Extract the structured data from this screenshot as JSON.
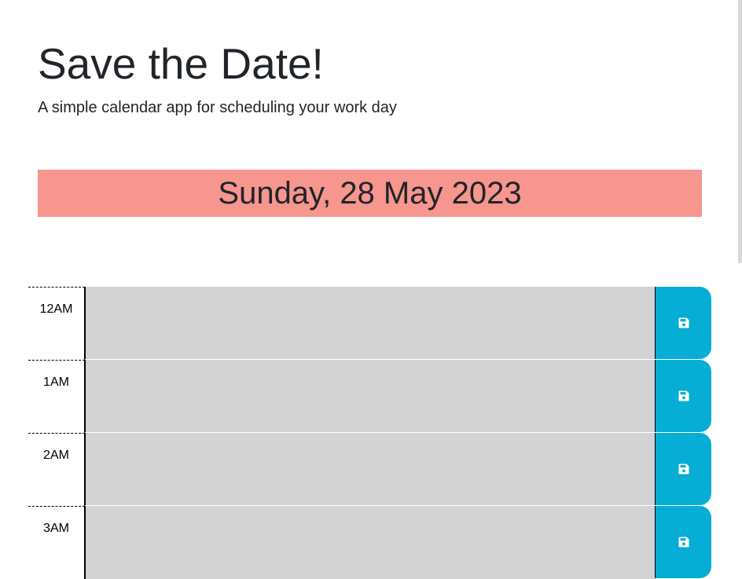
{
  "header": {
    "title": "Save the Date!",
    "subtitle": "A simple calendar app for scheduling your work day"
  },
  "current_day": "Sunday, 28 May 2023",
  "colors": {
    "banner": "#f7958f",
    "entry_past": "#d3d3d3",
    "save_button": "#06aed5"
  },
  "time_blocks": [
    {
      "hour": "12AM",
      "text": "",
      "save_icon": "floppy-disk-icon"
    },
    {
      "hour": "1AM",
      "text": "",
      "save_icon": "floppy-disk-icon"
    },
    {
      "hour": "2AM",
      "text": "",
      "save_icon": "floppy-disk-icon"
    },
    {
      "hour": "3AM",
      "text": "",
      "save_icon": "floppy-disk-icon"
    }
  ]
}
